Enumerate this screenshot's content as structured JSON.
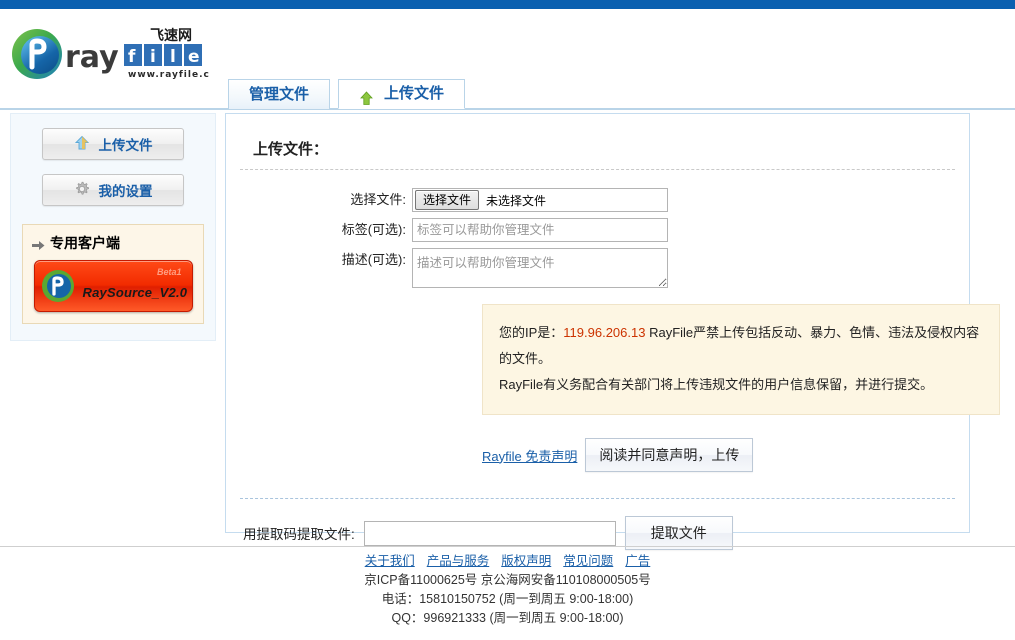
{
  "brand": {
    "logo_text": "rayfile",
    "logo_cn": "飞速网",
    "logo_url": "www.rayfile.com"
  },
  "tabs": [
    {
      "label": "管理文件",
      "icon": "",
      "active": false
    },
    {
      "label": "上传文件",
      "icon": "upload-arrow-icon",
      "active": true
    }
  ],
  "sidebar": {
    "buttons": [
      {
        "label": "上传文件",
        "icon": "upload-arrow-icon"
      },
      {
        "label": "我的设置",
        "icon": "gear-icon"
      }
    ],
    "client_box": {
      "title": "专用客户端",
      "arrow_icon": "arrow-right-icon",
      "banner_beta": "Beta1",
      "banner_name": "RaySource_V2.0"
    }
  },
  "main": {
    "title": "上传文件：",
    "fields": {
      "file": {
        "label": "选择文件:",
        "button_label": "选择文件",
        "status": "未选择文件"
      },
      "tag": {
        "label": "标签(可选):",
        "placeholder": "标签可以帮助你管理文件",
        "value": ""
      },
      "desc": {
        "label": "描述(可选):",
        "placeholder": "描述可以帮助你管理文件",
        "value": ""
      }
    },
    "notice": {
      "prefix": "您的IP是：",
      "ip": "119.96.206.13",
      "line1_rest": " RayFile严禁上传包括反动、暴力、色情、违法及侵权内容的文件。",
      "line2": "RayFile有义务配合有关部门将上传违规文件的用户信息保留，并进行提交。",
      "ip_color": "#cc3300"
    },
    "disclaimer_link": "Rayfile 免责声明",
    "agree_button": "阅读并同意声明，上传",
    "extract": {
      "label": "用提取码提取文件:",
      "value": "",
      "placeholder": "",
      "button_label": "提取文件"
    }
  },
  "footer": {
    "links": [
      "关于我们",
      "产品与服务",
      "版权声明",
      "常见问题",
      "广告"
    ],
    "icp": "京ICP备11000625号  京公海网安备110108000505号",
    "phone": "电话：15810150752 (周一到周五 9:00-18:00)",
    "qq": "QQ：996921333     (周一到周五 9:00-18:00)"
  },
  "theme": {
    "topbar": "#0a60b0",
    "link": "#1a5fa8",
    "panel_border": "#c5dcef"
  }
}
